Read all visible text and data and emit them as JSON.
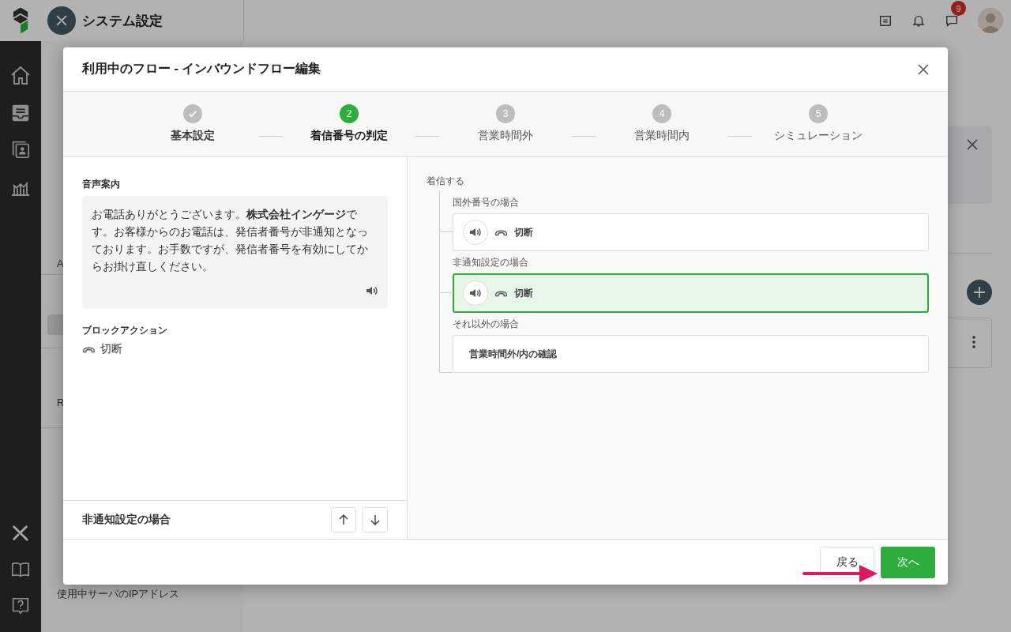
{
  "app": {
    "title": "システム設定",
    "notification_count": "9"
  },
  "sidebar": {
    "groups": [
      {
        "items": [
          {
            "label": "A",
            "selected": false
          }
        ]
      },
      {
        "items": [
          {
            "selected": true
          }
        ]
      },
      {
        "items": [
          {
            "label": "R",
            "selected": false
          }
        ]
      },
      {
        "items": [
          {
            "label": "使用中サーバのIPアドレス",
            "selected": false
          }
        ]
      }
    ]
  },
  "dialog": {
    "title": "利用中のフロー - インバウンドフロー編集",
    "steps": [
      {
        "label": "基本設定",
        "completed": true,
        "current": false
      },
      {
        "number": "2",
        "label": "着信番号の判定",
        "completed": false,
        "current": true
      },
      {
        "number": "3",
        "label": "営業時間外",
        "completed": false,
        "current": false
      },
      {
        "number": "4",
        "label": "営業時間内",
        "completed": false,
        "current": false
      },
      {
        "number": "5",
        "label": "シミュレーション",
        "completed": false,
        "current": false
      }
    ],
    "voice_guidance": {
      "label": "音声案内",
      "text": "お電話ありがとうございます。**株式会社インゲージ**です。お客様からのお電話は、発信者番号が非通知となっております。お手数ですが、発信者番号を有効にしてからお掛け直しください。"
    },
    "block_action": {
      "label": "ブロックアクション",
      "action": "切断"
    },
    "bottom_bar": {
      "title": "非通知設定の場合"
    },
    "flow": {
      "root": "着信する",
      "branches": [
        {
          "label": "国外番号の場合",
          "kind": "action",
          "text": "切断",
          "selected": false
        },
        {
          "label": "非通知設定の場合",
          "kind": "action",
          "text": "切断",
          "selected": true
        },
        {
          "label": "それ以外の場合",
          "kind": "link",
          "text": "営業時間外/内の確認",
          "selected": false
        }
      ]
    },
    "buttons": {
      "back": "戻る",
      "next": "次へ"
    }
  }
}
